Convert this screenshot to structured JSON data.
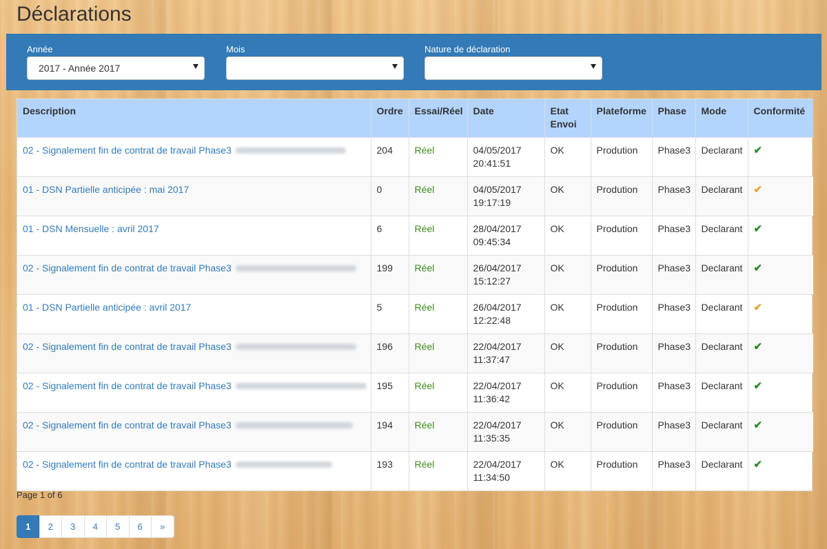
{
  "page": {
    "title": "Déclarations"
  },
  "filters": {
    "annee": {
      "label": "Année",
      "value": "2017 - Année 2017"
    },
    "mois": {
      "label": "Mois",
      "value": ""
    },
    "nature": {
      "label": "Nature de déclaration",
      "value": ""
    }
  },
  "table": {
    "headers": [
      "Description",
      "Ordre",
      "Essai/Réel",
      "Date",
      "Etat Envoi",
      "Plateforme",
      "Phase",
      "Mode",
      "Conformité"
    ],
    "rows": [
      {
        "description": "02 - Signalement fin de contrat de travail Phase3",
        "blurred": true,
        "blur_w": 160,
        "ordre": "204",
        "type": "Réel",
        "date": "04/05/2017",
        "time": "20:41:51",
        "etat": "OK",
        "plateforme": "Prodution",
        "phase": "Phase3",
        "mode": "Declarant",
        "conformite": "ok"
      },
      {
        "description": "01 - DSN Partielle anticipée : mai 2017",
        "blurred": false,
        "ordre": "0",
        "type": "Réel",
        "date": "04/05/2017",
        "time": "19:17:19",
        "etat": "OK",
        "plateforme": "Prodution",
        "phase": "Phase3",
        "mode": "Declarant",
        "conformite": "warn"
      },
      {
        "description": "01 - DSN Mensuelle : avril 2017",
        "blurred": false,
        "ordre": "6",
        "type": "Réel",
        "date": "28/04/2017",
        "time": "09:45:34",
        "etat": "OK",
        "plateforme": "Prodution",
        "phase": "Phase3",
        "mode": "Declarant",
        "conformite": "ok"
      },
      {
        "description": "02 - Signalement fin de contrat de travail Phase3",
        "blurred": true,
        "blur_w": 175,
        "ordre": "199",
        "type": "Réel",
        "date": "26/04/2017",
        "time": "15:12:27",
        "etat": "OK",
        "plateforme": "Prodution",
        "phase": "Phase3",
        "mode": "Declarant",
        "conformite": "ok"
      },
      {
        "description": "01 - DSN Partielle anticipée : avril 2017",
        "blurred": false,
        "ordre": "5",
        "type": "Réel",
        "date": "26/04/2017",
        "time": "12:22:48",
        "etat": "OK",
        "plateforme": "Prodution",
        "phase": "Phase3",
        "mode": "Declarant",
        "conformite": "warn"
      },
      {
        "description": "02 - Signalement fin de contrat de travail Phase3",
        "blurred": true,
        "blur_w": 175,
        "ordre": "196",
        "type": "Réel",
        "date": "22/04/2017",
        "time": "11:37:47",
        "etat": "OK",
        "plateforme": "Prodution",
        "phase": "Phase3",
        "mode": "Declarant",
        "conformite": "ok"
      },
      {
        "description": "02 - Signalement fin de contrat de travail Phase3",
        "blurred": true,
        "blur_w": 190,
        "ordre": "195",
        "type": "Réel",
        "date": "22/04/2017",
        "time": "11:36:42",
        "etat": "OK",
        "plateforme": "Prodution",
        "phase": "Phase3",
        "mode": "Declarant",
        "conformite": "ok"
      },
      {
        "description": "02 - Signalement fin de contrat de travail Phase3",
        "blurred": true,
        "blur_w": 170,
        "ordre": "194",
        "type": "Réel",
        "date": "22/04/2017",
        "time": "11:35:35",
        "etat": "OK",
        "plateforme": "Prodution",
        "phase": "Phase3",
        "mode": "Declarant",
        "conformite": "ok"
      },
      {
        "description": "02 - Signalement fin de contrat de travail Phase3",
        "blurred": true,
        "blur_w": 140,
        "ordre": "193",
        "type": "Réel",
        "date": "22/04/2017",
        "time": "11:34:50",
        "etat": "OK",
        "plateforme": "Prodution",
        "phase": "Phase3",
        "mode": "Declarant",
        "conformite": "ok"
      }
    ]
  },
  "pagination": {
    "info": "Page 1 of 6",
    "pages": [
      "1",
      "2",
      "3",
      "4",
      "5",
      "6",
      "»"
    ],
    "active": "1"
  },
  "icons": {
    "ok": "check-icon",
    "warn": "check-warning-icon"
  },
  "colors": {
    "accent": "#337ab7",
    "header_bg": "#b3d4fc",
    "ok": "#2a8a2a",
    "warn": "#f0a030",
    "reel": "#3c8d1a"
  }
}
